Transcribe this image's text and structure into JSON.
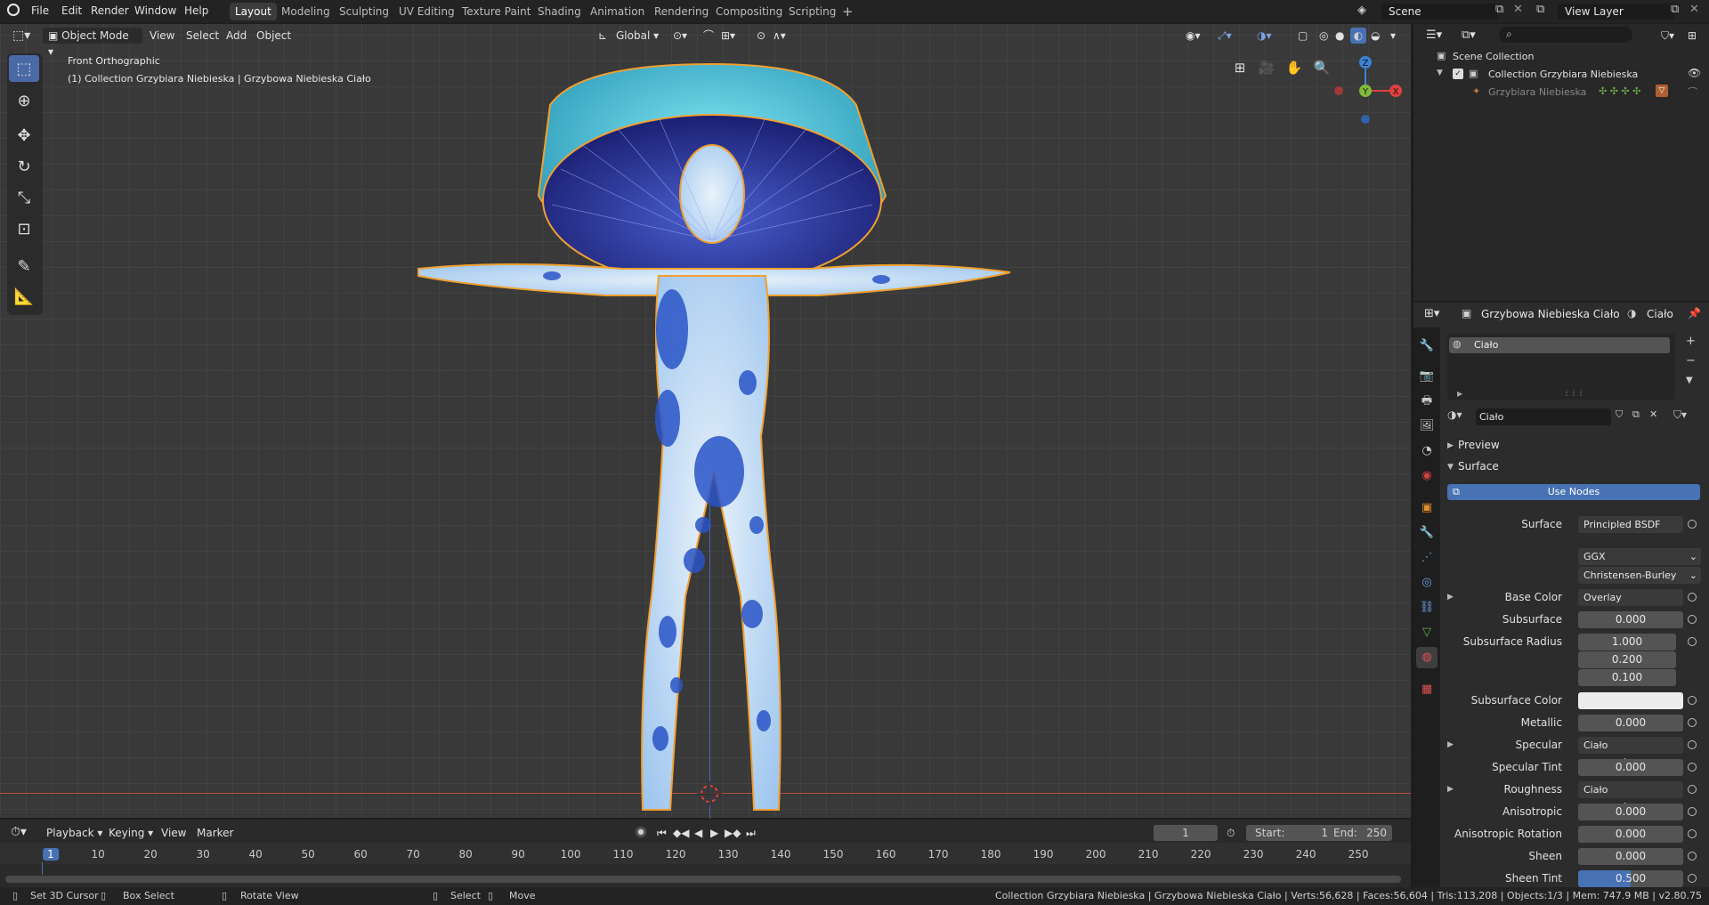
{
  "menu": {
    "file": "File",
    "edit": "Edit",
    "render": "Render",
    "window": "Window",
    "help": "Help"
  },
  "workspaces": [
    "Layout",
    "Modeling",
    "Sculpting",
    "UV Editing",
    "Texture Paint",
    "Shading",
    "Animation",
    "Rendering",
    "Compositing",
    "Scripting"
  ],
  "scene_name": "Scene",
  "view_layer": "View Layer",
  "viewport": {
    "mode": "Object Mode",
    "menus": [
      "View",
      "Select",
      "Add",
      "Object"
    ],
    "orientation": "Global",
    "view_title": "Front Orthographic",
    "view_subtitle": "(1) Collection Grzybiara Niebieska | Grzybowa Niebieska Ciało",
    "axis_z": "Z",
    "axis_y": "Y",
    "axis_x": "X"
  },
  "timeline": {
    "menus": [
      "Playback",
      "Keying",
      "View",
      "Marker"
    ],
    "current_frame": "1",
    "start_label": "Start:",
    "start": "1",
    "end_label": "End:",
    "end": "250",
    "ticks": [
      "1",
      "10",
      "20",
      "30",
      "40",
      "50",
      "60",
      "70",
      "80",
      "90",
      "100",
      "110",
      "120",
      "130",
      "140",
      "150",
      "160",
      "170",
      "180",
      "190",
      "200",
      "210",
      "220",
      "230",
      "240",
      "250"
    ]
  },
  "statusbar": {
    "set_cursor": "Set 3D Cursor",
    "box_select": "Box Select",
    "rotate_view": "Rotate View",
    "select": "Select",
    "move": "Move",
    "stats": "Collection Grzybiara Niebieska | Grzybowa Niebieska Ciało | Verts:56,628 | Faces:56,604 | Tris:113,208 | Objects:1/3 | Mem: 747.9 MB | v2.80.75"
  },
  "outliner": {
    "scene_collection": "Scene Collection",
    "collection": "Collection Grzybiara Niebieska",
    "object": "Grzybiara Niebieska"
  },
  "properties": {
    "object_name": "Grzybowa Niebieska Ciało",
    "material_name": "Ciało",
    "slot_name": "Ciało",
    "material_field": "Ciało",
    "preview": "Preview",
    "surface_panel": "Surface",
    "use_nodes": "Use Nodes",
    "surface_label": "Surface",
    "surface_value": "Principled BSDF",
    "distribution": "GGX",
    "subsurface_method": "Christensen-Burley",
    "rows": [
      {
        "label": "Base Color",
        "value": "Overlay",
        "type": "link",
        "expand": true
      },
      {
        "label": "Subsurface",
        "value": "0.000",
        "type": "num"
      },
      {
        "label": "Subsurface Radius",
        "value": "1.000",
        "type": "num"
      },
      {
        "label": "",
        "value": "0.200",
        "type": "num"
      },
      {
        "label": "",
        "value": "0.100",
        "type": "num"
      },
      {
        "label": "Subsurface Color",
        "value": "",
        "type": "color"
      },
      {
        "label": "Metallic",
        "value": "0.000",
        "type": "num"
      },
      {
        "label": "Specular",
        "value": "Ciało grzy...eska_s.png",
        "type": "link",
        "expand": true
      },
      {
        "label": "Specular Tint",
        "value": "0.000",
        "type": "num"
      },
      {
        "label": "Roughness",
        "value": "Ciało grzy...eska_r.png",
        "type": "link",
        "expand": true
      },
      {
        "label": "Anisotropic",
        "value": "0.000",
        "type": "num"
      },
      {
        "label": "Anisotropic Rotation",
        "value": "0.000",
        "type": "num"
      },
      {
        "label": "Sheen",
        "value": "0.000",
        "type": "num"
      },
      {
        "label": "Sheen Tint",
        "value": "0.500",
        "type": "num",
        "fill": 0.5
      }
    ]
  },
  "colors": {
    "accent": "#4772b3",
    "selection_orange": "#f0a030",
    "mushroom_blue": "#3a5bd0",
    "cap_cyan": "#4ec0d8"
  }
}
